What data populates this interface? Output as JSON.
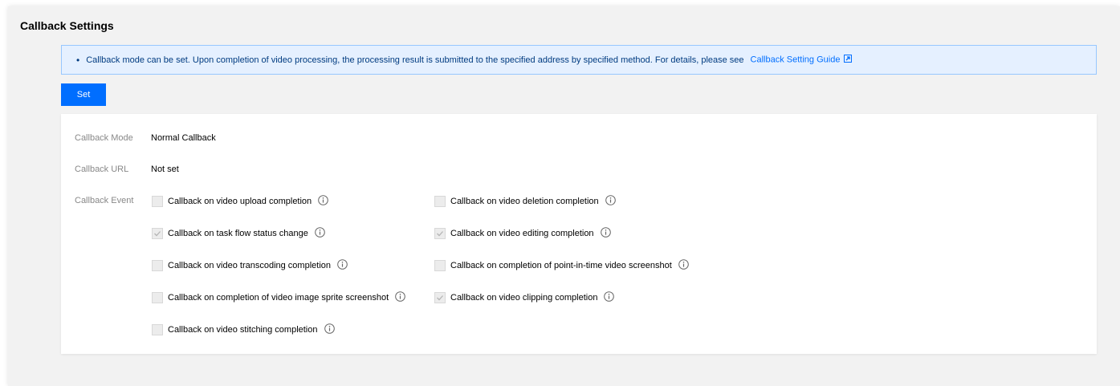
{
  "page": {
    "title": "Callback Settings"
  },
  "notice": {
    "text": "Callback mode can be set. Upon completion of video processing, the processing result is submitted to the specified address by specified method. For details, please see",
    "link_label": "Callback Setting Guide",
    "link_icon": "external-link-icon"
  },
  "actions": {
    "set_label": "Set"
  },
  "settings": {
    "mode_label": "Callback Mode",
    "mode_value": "Normal Callback",
    "url_label": "Callback URL",
    "url_value": "Not set",
    "event_label": "Callback Event"
  },
  "events": [
    {
      "label": "Callback on video upload completion",
      "checked": false
    },
    {
      "label": "Callback on video deletion completion",
      "checked": false
    },
    {
      "label": "Callback on task flow status change",
      "checked": true
    },
    {
      "label": "Callback on video editing completion",
      "checked": true
    },
    {
      "label": "Callback on video transcoding completion",
      "checked": false
    },
    {
      "label": "Callback on completion of point-in-time video screenshot",
      "checked": false
    },
    {
      "label": "Callback on completion of video image sprite screenshot",
      "checked": false
    },
    {
      "label": "Callback on video clipping completion",
      "checked": true
    },
    {
      "label": "Callback on video stitching completion",
      "checked": false
    }
  ],
  "colors": {
    "primary": "#006eff",
    "notice_bg": "#e5f0ff",
    "notice_border": "#97c7ff",
    "page_bg": "#f2f2f2"
  }
}
